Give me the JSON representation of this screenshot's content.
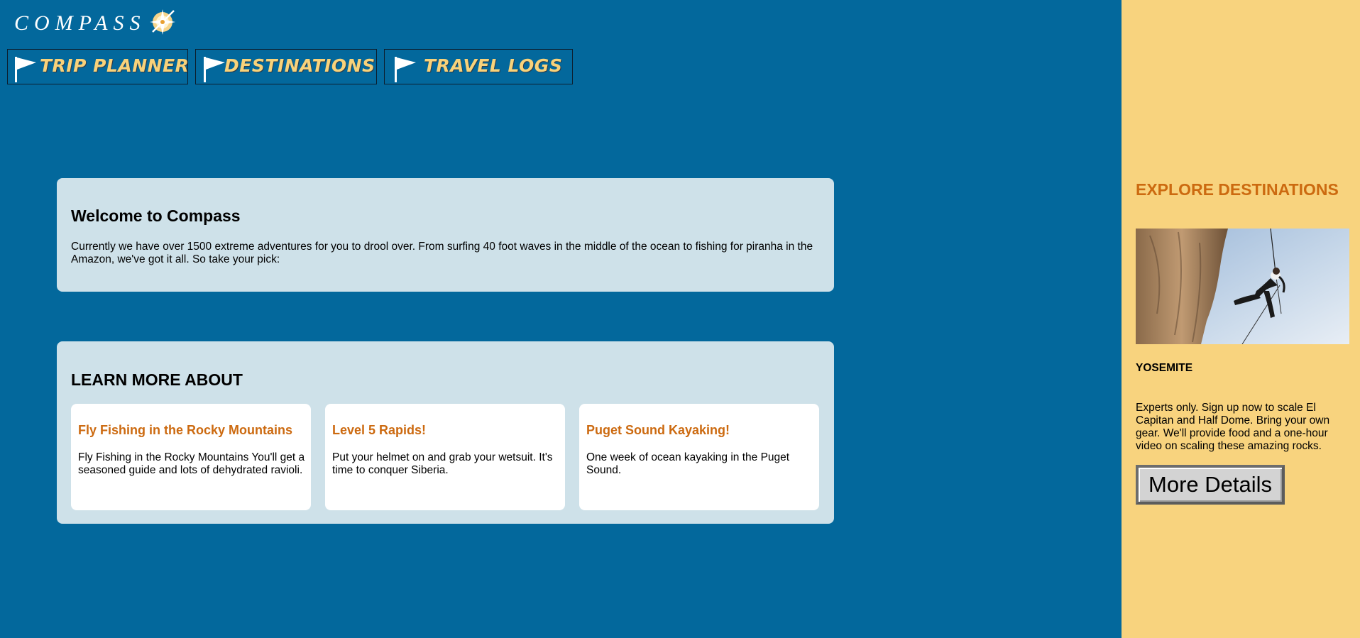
{
  "brand": {
    "name": "COMPASS",
    "logo_icon": "compass-star-icon"
  },
  "nav": {
    "items": [
      {
        "label": "TRIP PLANNER",
        "icon": "flag-icon"
      },
      {
        "label": "DESTINATIONS",
        "icon": "flag-icon"
      },
      {
        "label": "TRAVEL LOGS",
        "icon": "flag-icon"
      }
    ]
  },
  "welcome": {
    "title": "Welcome to Compass",
    "body": "Currently we have over 1500 extreme adventures for you to drool over. From surfing 40 foot waves in the middle of the ocean to fishing for piranha in the Amazon, we've got it all. So take your pick:"
  },
  "learn": {
    "title": "LEARN MORE ABOUT",
    "cards": [
      {
        "title": "Fly Fishing in the Rocky Mountains",
        "body": "Fly Fishing in the Rocky Mountains You'll get a seasoned guide and lots of dehydrated ravioli."
      },
      {
        "title": "Level 5 Rapids!",
        "body": "Put your helmet on and grab your wetsuit. It's time to conquer Siberia."
      },
      {
        "title": "Puget Sound Kayaking!",
        "body": "One week of ocean kayaking in the Puget Sound."
      }
    ]
  },
  "sidebar": {
    "title": "EXPLORE DESTINATIONS",
    "image_icon": "rock-climber-photo",
    "place": "YOSEMITE",
    "description": "Experts only. Sign up now to scale El Capitan and Half Dome. Bring your own gear. We'll provide food and a one-hour video on scaling these amazing rocks.",
    "button_label": "More Details"
  },
  "colors": {
    "background": "#03689c",
    "nav_text": "#f8d27a",
    "panel": "#cee1e9",
    "accent": "#cc6a10",
    "sidebar": "#f8d37e"
  }
}
